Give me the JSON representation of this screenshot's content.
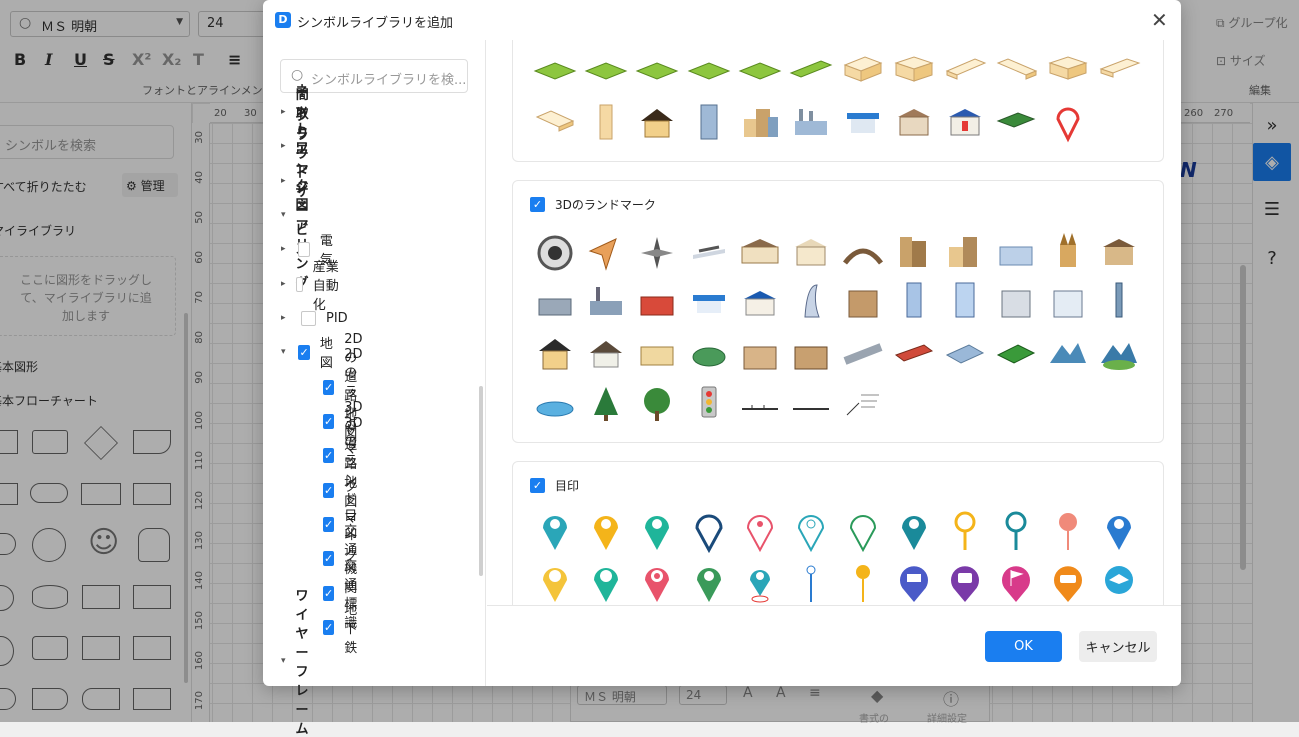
{
  "app": {
    "font_name": "ＭＳ 明朝",
    "font_size": "24",
    "group_font_label": "フォントとアラインメント",
    "group_edit_label": "編集",
    "group_button": "グループ化",
    "size_button": "サイズ",
    "left_search_placeholder": "シンボルを検索",
    "collapse_all": "すべて折りたたむ",
    "manage": "管理",
    "my_library": "マイライブラリ",
    "drop_hint": "ここに図形をドラッグして、マイライブラリに追加します",
    "basic_shapes": "基本図形",
    "basic_flowchart": "基本フローチャート",
    "ruler_top": [
      "20",
      "30",
      "260",
      "270"
    ],
    "ruler_left": [
      "30",
      "40",
      "50",
      "60",
      "70",
      "80",
      "90",
      "100",
      "110",
      "120",
      "130",
      "140",
      "150",
      "160",
      "170"
    ],
    "bottom_font": "ＭＳ 明朝",
    "bottom_size": "24",
    "bottom_style": "書式の",
    "bottom_detail": "詳細設定"
  },
  "dialog": {
    "title": "シンボルライブラリを追加",
    "search_placeholder": "シンボルライブラリを検...",
    "tree": [
      {
        "label": "間取り",
        "arrow": "▸",
        "checkbox": null,
        "bold": true
      },
      {
        "label": "ネットワーク図",
        "arrow": "▸",
        "checkbox": null,
        "bold": true
      },
      {
        "label": "クラウドサービス",
        "arrow": "▸",
        "checkbox": null,
        "bold": true
      },
      {
        "label": "エンジニアリング",
        "arrow": "▾",
        "checkbox": null,
        "bold": true
      },
      {
        "label": "電気",
        "arrow": "▸",
        "checkbox": false,
        "bold": false
      },
      {
        "label": "産業自動化",
        "arrow": "▸",
        "checkbox": false,
        "bold": false
      },
      {
        "label": "PID",
        "arrow": "▸",
        "checkbox": false,
        "bold": false
      },
      {
        "label": "地図",
        "arrow": "▾",
        "checkbox": true,
        "bold": false
      },
      {
        "label": "2Dの道路地図",
        "arrow": "",
        "checkbox": true,
        "bold": false
      },
      {
        "label": "2Dのランドマーク",
        "arrow": "",
        "checkbox": true,
        "bold": false
      },
      {
        "label": "3Dの道路地図",
        "arrow": "",
        "checkbox": true,
        "bold": false
      },
      {
        "label": "3Dのランドマーク",
        "arrow": "",
        "checkbox": true,
        "bold": false
      },
      {
        "label": "目印",
        "arrow": "",
        "checkbox": true,
        "bold": false
      },
      {
        "label": "交通機関",
        "arrow": "",
        "checkbox": true,
        "bold": false
      },
      {
        "label": "交通標識",
        "arrow": "",
        "checkbox": true,
        "bold": false
      },
      {
        "label": "地下鉄",
        "arrow": "",
        "checkbox": true,
        "bold": false
      },
      {
        "label": "ワイヤーフレーム",
        "arrow": "▾",
        "checkbox": null,
        "bold": true
      }
    ],
    "sections": [
      {
        "label": "3Dのランドマーク",
        "checked": true
      },
      {
        "label": "目印",
        "checked": true
      }
    ],
    "ok_label": "OK",
    "cancel_label": "キャンセル",
    "colors": {
      "accent": "#1a7ef0",
      "grass": "#8dc63f",
      "building": "#f5d9a4",
      "pin_red": "#e53935"
    }
  }
}
